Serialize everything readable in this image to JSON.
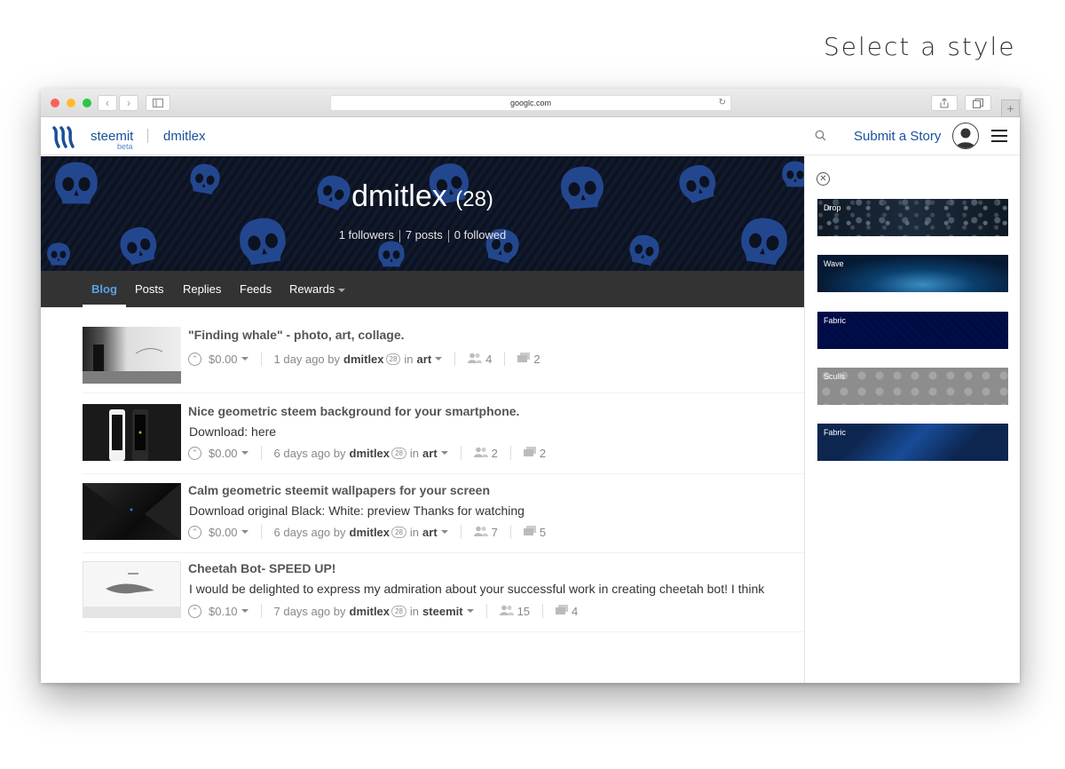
{
  "page_heading": "Select a style",
  "browser": {
    "url": "googlc.com",
    "new_tab_label": "+"
  },
  "header": {
    "brand": "steemit",
    "beta": "beta",
    "username": "dmitlex",
    "submit_label": "Submit a Story"
  },
  "profile": {
    "name": "dmitlex",
    "reputation": "(28)",
    "followers": "1 followers",
    "posts": "7 posts",
    "followed": "0 followed"
  },
  "tabs": [
    "Blog",
    "Posts",
    "Replies",
    "Feeds",
    "Rewards"
  ],
  "posts": [
    {
      "title": "\"Finding whale\" - photo, art, collage.",
      "desc": "",
      "payout": "$0.00",
      "time": "1 day ago by",
      "author": "dmitlex",
      "rep": "28",
      "in": "in",
      "category": "art",
      "votes": "4",
      "comments": "2"
    },
    {
      "title": "Nice geometric steem background for your smartphone.",
      "desc": "Download: here",
      "payout": "$0.00",
      "time": "6 days ago by",
      "author": "dmitlex",
      "rep": "28",
      "in": "in",
      "category": "art",
      "votes": "2",
      "comments": "2"
    },
    {
      "title": "Calm geometric steemit wallpapers for your screen",
      "desc": "Download original Black: White: preview Thanks for watching",
      "payout": "$0.00",
      "time": "6 days ago by",
      "author": "dmitlex",
      "rep": "28",
      "in": "in",
      "category": "art",
      "votes": "7",
      "comments": "5"
    },
    {
      "title": "Cheetah Bot- SPEED UP!",
      "desc": "I would be delighted to express my admiration about your successful work in creating cheetah bot! I think",
      "payout": "$0.10",
      "time": "7 days ago by",
      "author": "dmitlex",
      "rep": "28",
      "in": "in",
      "category": "steemit",
      "votes": "15",
      "comments": "4"
    }
  ],
  "styles": [
    "Drop",
    "Wave",
    "Fabric",
    "Sculls",
    "Fabric"
  ],
  "colors": {
    "accent": "#1a5099",
    "active_tab": "#5aa1e4",
    "tabbar": "#333333",
    "hero_bg": "#0c1220"
  }
}
